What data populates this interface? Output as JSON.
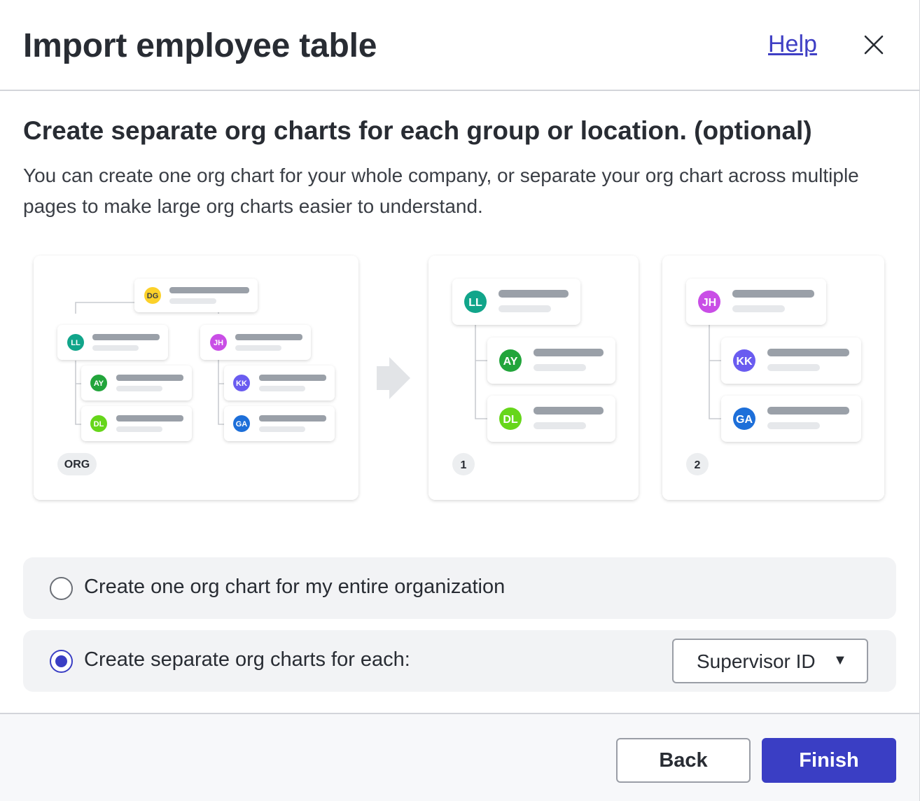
{
  "dialog": {
    "title": "Import employee table",
    "help_label": "Help"
  },
  "content": {
    "subtitle": "Create separate org charts for each group or location. (optional)",
    "description": "You can create one org chart for your whole company, or separate your org chart across multiple pages to make large org charts easier to understand."
  },
  "illustration": {
    "org_badge": "ORG",
    "page1_badge": "1",
    "page2_badge": "2",
    "avatars": {
      "root": "DG",
      "ll": "LL",
      "jh": "JH",
      "ay": "AY",
      "dl": "DL",
      "kk": "KK",
      "ga": "GA"
    },
    "colors": {
      "dg": "#fcd12a",
      "ll": "#11a58a",
      "jh": "#c94ee6",
      "ay": "#22a53b",
      "dl": "#66d61a",
      "kk": "#6a5cf0",
      "ga": "#1d6fd9",
      "placeholder": "#9aa0a8"
    }
  },
  "options": {
    "one_label": "Create one org chart for my entire organization",
    "one_selected": false,
    "separate_label": "Create separate org charts for each:",
    "separate_selected": true,
    "group_by_value": "Supervisor ID"
  },
  "footer": {
    "back_label": "Back",
    "finish_label": "Finish"
  }
}
